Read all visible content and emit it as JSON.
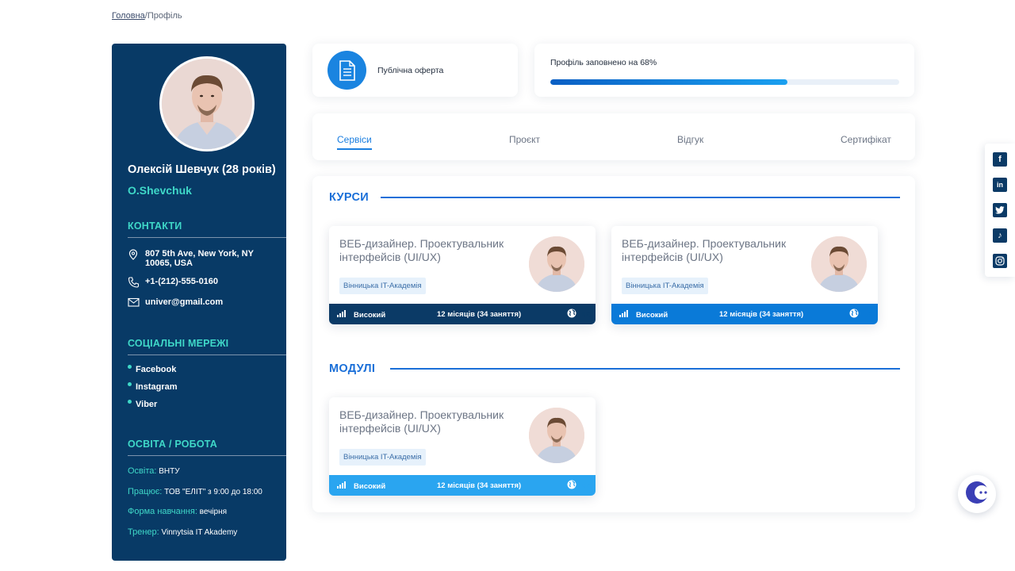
{
  "breadcrumb": {
    "home": "Головна",
    "separator": "/",
    "current": "Профіль"
  },
  "profile": {
    "name": "Олексій Шевчук (28 років)",
    "nickname": "O.Shevchuk",
    "avatar_icon": "user-avatar-photo"
  },
  "contacts": {
    "title": "КОНТАКТИ",
    "address": "807 5th Ave, New York, NY 10065, USA",
    "phone": "+1-(212)-555-0160",
    "email": "univer@gmail.com"
  },
  "socials": {
    "title": "СОЦІАЛЬНІ МЕРЕЖІ",
    "items": [
      "Facebook",
      "Instagram",
      "Viber"
    ]
  },
  "education": {
    "title": "ОСВІТА / РОБОТА",
    "rows": [
      {
        "key": "Освіта:",
        "value": "ВНТУ"
      },
      {
        "key": "Працює:",
        "value": "ТОВ \"ЕЛІТ\" з 9:00 до 18:00"
      },
      {
        "key": "Форма навчання:",
        "value": "вечірня"
      },
      {
        "key": "Тренер:",
        "value": "Vinnytsia IT Akademy"
      }
    ]
  },
  "offer": {
    "label": "Публічна оферта",
    "icon": "document-icon"
  },
  "progress": {
    "label": "Профіль заповнено на 68%",
    "percent": 68
  },
  "tabs": [
    "Сервіси",
    "Проєкт",
    "Відгук",
    "Сертифікат"
  ],
  "courses_section": {
    "title": "КУРСИ",
    "items": [
      {
        "title": "ВЕБ-дизайнер. Проектувальник інтерфейсів (UI/UX)",
        "tag": "Вінницька IT-Академія",
        "level": "Високий",
        "duration": "12 місяців (34 заняття)",
        "lang": "ua",
        "bar_color": "#0b3a66"
      },
      {
        "title": "ВЕБ-дизайнер. Проектувальник інтерфейсів (UI/UX)",
        "tag": "Вінницька IT-Академія",
        "level": "Високий",
        "duration": "12 місяців (34 заняття)",
        "lang": "ua",
        "bar_color": "#0a7ad8"
      }
    ]
  },
  "modules_section": {
    "title": "МОДУЛІ",
    "items": [
      {
        "title": "ВЕБ-дизайнер. Проектувальник інтерфейсів (UI/UX)",
        "tag": "Вінницька IT-Академія",
        "level": "Високий",
        "duration": "12 місяців (34 заняття)",
        "lang": "ua",
        "bar_color": "#2aa5f0"
      }
    ]
  },
  "rail_icons": [
    "facebook-icon",
    "linkedin-icon",
    "twitter-icon",
    "tiktok-icon",
    "instagram-icon"
  ],
  "colors": {
    "sidebar": "#083a66",
    "accent": "#1a7ee0",
    "teal": "#3fd8c8"
  }
}
